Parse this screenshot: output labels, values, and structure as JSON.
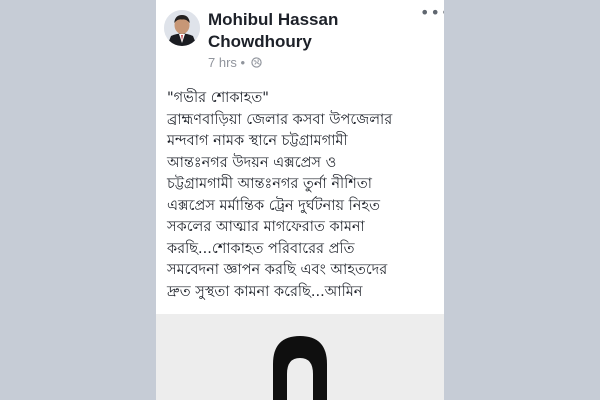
{
  "post": {
    "author": "Mohibul Hassan Chowdhoury",
    "time": "7 hrs",
    "separator": "•",
    "privacy_icon": "globe-icon",
    "more_icon": "more-options-icon",
    "more_label": "•••",
    "text_lines": [
      "\"গভীর শোকাহত\"",
      "ব্রাহ্মণবাড়িয়া জেলার কসবা উপজেলার",
      "মন্দবাগ নামক স্থানে চট্টগ্রামগামী",
      "আন্তঃনগর উদয়ন এক্সপ্রেস ও",
      "চট্টগ্রামগামী আন্তঃনগর তুর্না নীশিতা",
      "এক্সপ্রেস মর্মান্তিক ট্রেন দুর্ঘটনায় নিহত",
      "সকলের আত্মার মাগফেরাত কামনা",
      "করছি...শোকাহত পরিবারের প্রতি",
      "সমবেদনা জ্ঞাপন করছি এবং আহতদের",
      "দ্রুত সুস্থতা কামনা করেছি...আমিন"
    ]
  },
  "colors": {
    "page_background": "#c6ccd6",
    "card_background": "#ffffff",
    "text": "#1d2129",
    "meta_text": "#90949c",
    "mourning_ribbon": "#0f0f0f"
  }
}
